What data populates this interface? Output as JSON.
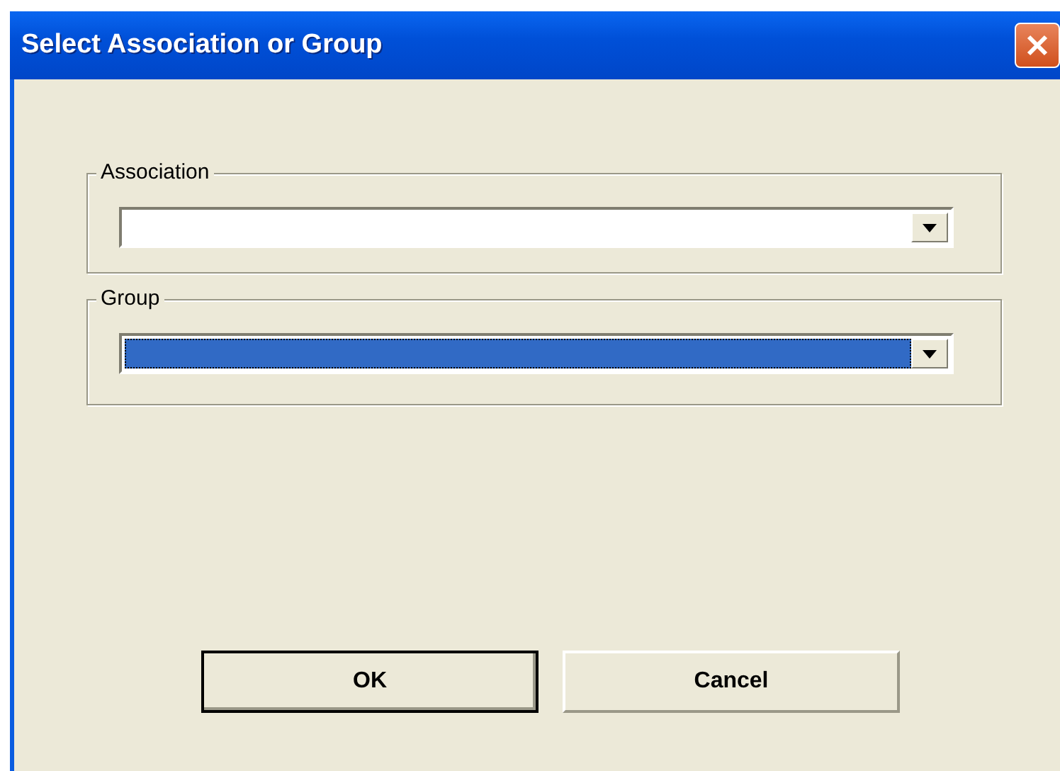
{
  "window": {
    "title": "Select Association or Group"
  },
  "groups": [
    {
      "label": "Association",
      "focused": false
    },
    {
      "label": "Group",
      "focused": true
    }
  ],
  "buttons": [
    {
      "label": "OK",
      "default": true
    },
    {
      "label": "Cancel",
      "default": false
    }
  ]
}
